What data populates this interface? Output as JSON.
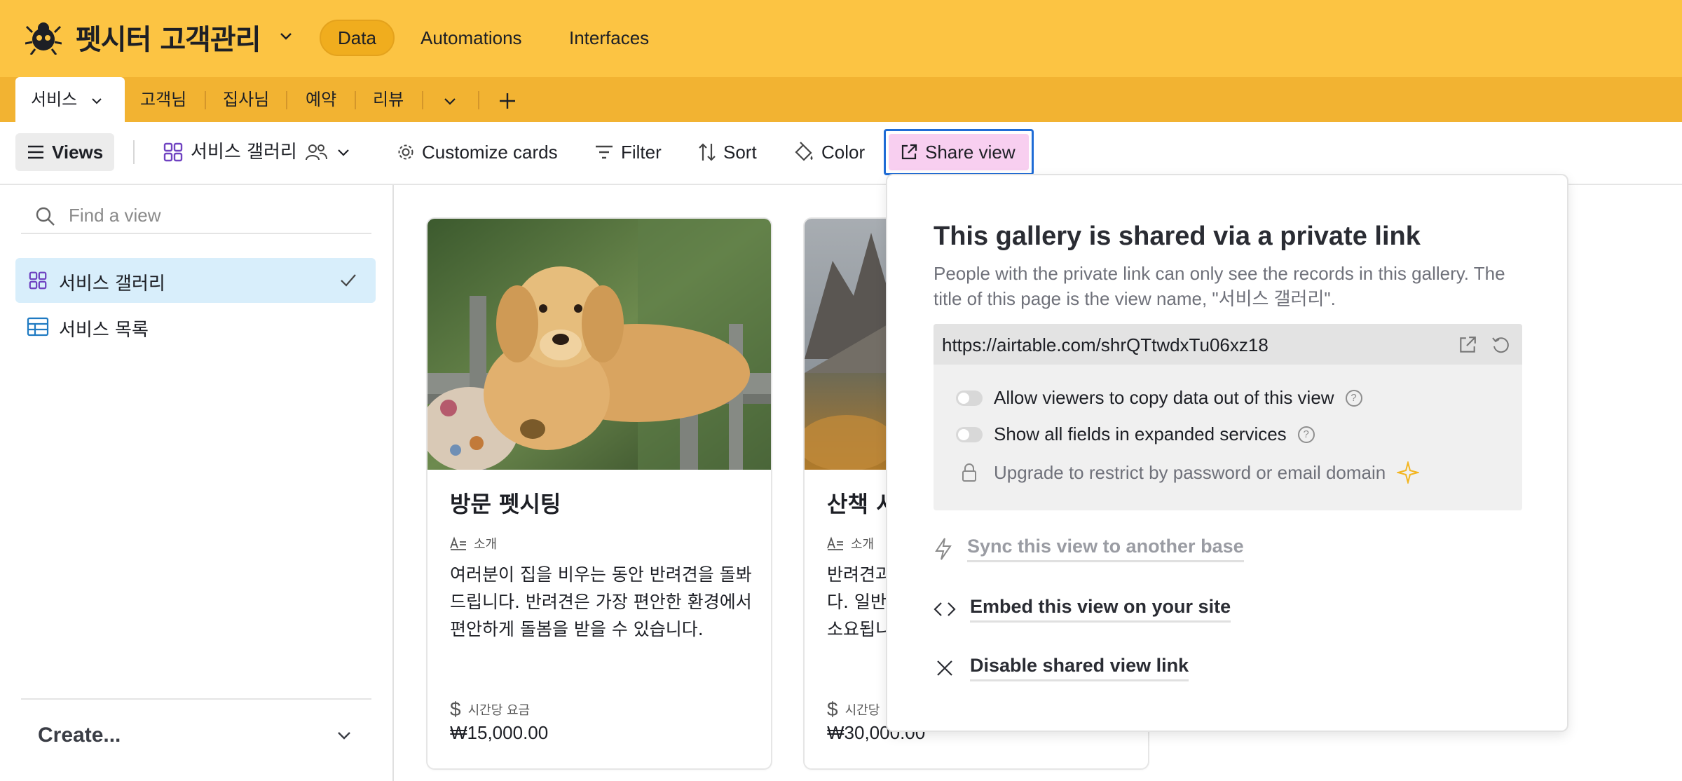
{
  "app": {
    "base_name": "펫시터 고객관리",
    "nav": [
      "Data",
      "Automations",
      "Interfaces"
    ]
  },
  "tables": {
    "active": "서비스",
    "others": [
      "고객님",
      "집사님",
      "예약",
      "리뷰"
    ]
  },
  "toolbar": {
    "views": "Views",
    "current_view": "서비스 갤러리",
    "customize": "Customize cards",
    "filter": "Filter",
    "sort": "Sort",
    "color": "Color",
    "share": "Share view"
  },
  "sidebar": {
    "search_placeholder": "Find a view",
    "views": [
      {
        "label": "서비스 갤러리",
        "selected": true
      },
      {
        "label": "서비스 목록",
        "selected": false
      }
    ],
    "create": "Create..."
  },
  "cards": [
    {
      "title": "방문 펫시팅",
      "desc_label": "소개",
      "desc_lines": [
        "여러분이 집을 비우는 동안 반려견을 돌봐",
        "드립니다. 반려견은 가장 편안한 환경에서",
        "편안하게 돌봄을 받을 수 있습니다."
      ],
      "price_label": "시간당 요금",
      "price": "₩15,000.00"
    },
    {
      "title": "산책 서",
      "desc_label": "소개",
      "desc_lines": [
        "반려견과",
        "다. 일반",
        "소요됩니"
      ],
      "price_label": "시간당",
      "price": "₩30,000.00"
    }
  ],
  "share": {
    "title": "This gallery is shared via a private link",
    "desc_line1": "People with the private link can only see the records in this gallery. The",
    "desc_line2": "title of this page is the view name, \"서비스 갤러리\".",
    "url": "https://airtable.com/shrQTtwdxTu06xz18",
    "option_copy": "Allow viewers to copy data out of this view",
    "option_fields": "Show all fields in expanded services",
    "option_upgrade": "Upgrade to restrict by password or email domain",
    "action_sync": "Sync this view to another base",
    "action_embed": "Embed this view on your site",
    "action_disable": "Disable shared view link"
  },
  "colors": {
    "appbar": "#fcc443",
    "tabsbar": "#f2b332",
    "share_highlight": "#f8cff0",
    "focus_ring": "#1f6cd6",
    "view_accent": "#6f42c1",
    "selected_view_bg": "#d8eefb"
  }
}
